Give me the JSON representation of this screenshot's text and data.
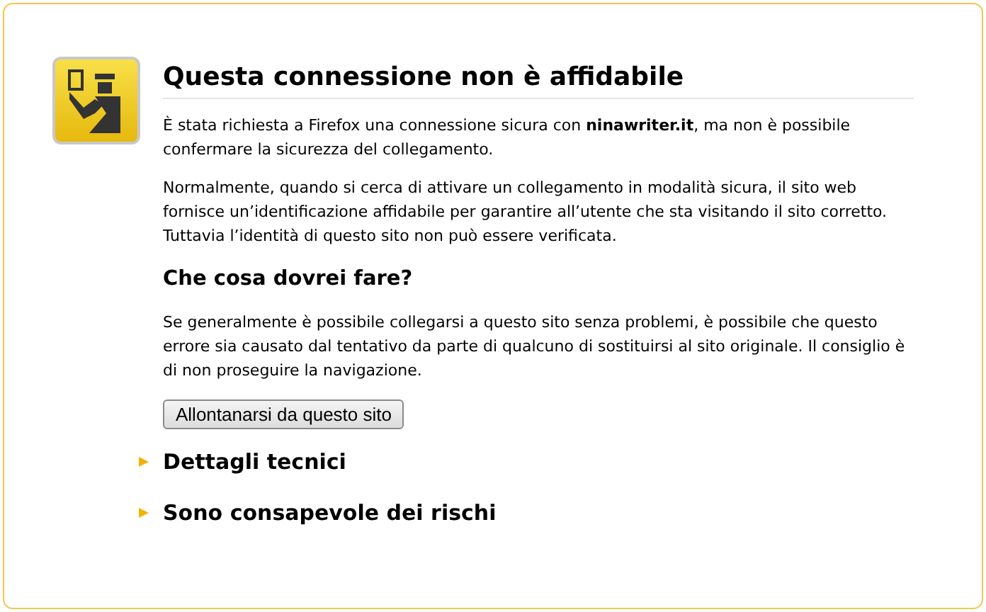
{
  "title": "Questa connessione non è affidabile",
  "intro": "È stata richiesta a Firefox una connessione sicura con **ninawriter.it**, ma non è possibile confermare la sicurezza del collegamento.",
  "explanation": "Normalmente, quando si cerca di attivare un collegamento in modalità sicura, il sito web fornisce un’identificazione affidabile per garantire all’utente che sta visitando il sito corretto. Tuttavia l’identità di questo sito non può essere verificata.",
  "what_to_do": {
    "heading": "Che cosa dovrei fare?",
    "text": "Se generalmente è possibile collegarsi a questo sito senza problemi, è possibile che questo errore sia causato dal tentativo da parte di qualcuno di sostituirsi al sito originale. Il consiglio è di non proseguire la navigazione.",
    "button": "Allontanarsi da questo sito"
  },
  "sections": [
    {
      "label": "Dettagli tecnici",
      "expanded": false
    },
    {
      "label": "Sono consapevole dei rischi",
      "expanded": false
    }
  ]
}
